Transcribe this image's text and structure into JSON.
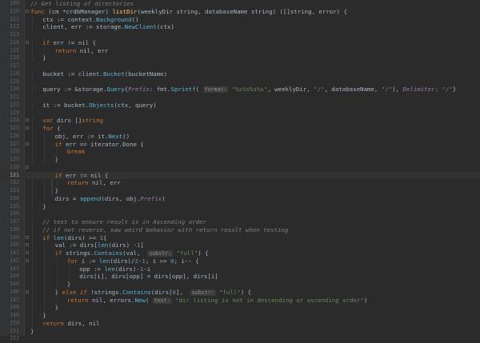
{
  "editor": {
    "line_numbers": [
      "109",
      "110",
      "111",
      "112",
      "113",
      "114",
      "115",
      "116",
      "117",
      "118",
      "119",
      "120",
      "121",
      "122",
      "123",
      "124",
      "125",
      "126",
      "127",
      "128",
      "129",
      "130",
      "131",
      "132",
      "133",
      "134",
      "135",
      "136",
      "137",
      "138",
      "139",
      "140",
      "141",
      "142",
      "143",
      "144",
      "145",
      "146",
      "147",
      "148",
      "149",
      "150",
      "151",
      "152"
    ],
    "current_line": "131",
    "lines": [
      {
        "indent": 0,
        "tokens": [
          {
            "c": "cm",
            "t": "// Get listing of directories"
          }
        ]
      },
      {
        "indent": 0,
        "tokens": [
          {
            "c": "kw",
            "t": "func "
          },
          {
            "t": "(cm *crdbManager) "
          },
          {
            "c": "fn",
            "t": "listDir"
          },
          {
            "t": "(weeklyDir string, databaseName string) ([]string, error) {"
          }
        ]
      },
      {
        "indent": 1,
        "tokens": [
          {
            "t": "ctx := context."
          },
          {
            "c": "call",
            "t": "Background"
          },
          {
            "t": "()"
          }
        ]
      },
      {
        "indent": 1,
        "tokens": [
          {
            "t": "client, err := storage."
          },
          {
            "c": "call",
            "t": "NewClient"
          },
          {
            "t": "(ctx)"
          }
        ]
      },
      {
        "indent": 0,
        "tokens": []
      },
      {
        "indent": 1,
        "tokens": [
          {
            "c": "kw",
            "t": "if "
          },
          {
            "t": "err != nil {"
          }
        ]
      },
      {
        "indent": 2,
        "tokens": [
          {
            "c": "kw",
            "t": "return "
          },
          {
            "t": "nil, err"
          }
        ]
      },
      {
        "indent": 1,
        "tokens": [
          {
            "t": "}"
          }
        ]
      },
      {
        "indent": 0,
        "tokens": []
      },
      {
        "indent": 1,
        "tokens": [
          {
            "t": "bucket := client."
          },
          {
            "c": "call",
            "t": "Bucket"
          },
          {
            "t": "(bucketName)"
          }
        ]
      },
      {
        "indent": 0,
        "tokens": []
      },
      {
        "indent": 1,
        "tokens": [
          {
            "t": "query := &storage."
          },
          {
            "c": "call",
            "t": "Query"
          },
          {
            "t": "{"
          },
          {
            "c": "fld",
            "t": "Prefix"
          },
          {
            "t": ": fmt."
          },
          {
            "c": "call",
            "t": "Sprintf"
          },
          {
            "t": "( "
          },
          {
            "c": "hint",
            "t": "format:"
          },
          {
            "t": " "
          },
          {
            "c": "str",
            "t": "\"%s%s%s%s\""
          },
          {
            "t": ", weeklyDir, "
          },
          {
            "c": "str",
            "t": "\"/\""
          },
          {
            "t": ", databaseName, "
          },
          {
            "c": "str",
            "t": "\"/\""
          },
          {
            "t": "), "
          },
          {
            "c": "fld",
            "t": "Delimiter"
          },
          {
            "t": ": "
          },
          {
            "c": "str",
            "t": "\"/\""
          },
          {
            "t": "}"
          }
        ]
      },
      {
        "indent": 0,
        "tokens": []
      },
      {
        "indent": 1,
        "tokens": [
          {
            "t": "it := bucket."
          },
          {
            "c": "call",
            "t": "Objects"
          },
          {
            "t": "(ctx, query)"
          }
        ]
      },
      {
        "indent": 0,
        "tokens": []
      },
      {
        "indent": 1,
        "tokens": [
          {
            "c": "kw",
            "t": "var "
          },
          {
            "t": "dirs []"
          },
          {
            "c": "kw",
            "t": "string"
          }
        ]
      },
      {
        "indent": 1,
        "tokens": [
          {
            "c": "kw",
            "t": "for "
          },
          {
            "t": "{"
          }
        ]
      },
      {
        "indent": 2,
        "tokens": [
          {
            "t": "obj, err := it."
          },
          {
            "c": "call",
            "t": "Next"
          },
          {
            "t": "()"
          }
        ]
      },
      {
        "indent": 2,
        "tokens": [
          {
            "c": "kw",
            "t": "if "
          },
          {
            "t": "err == iterator.Done {"
          }
        ]
      },
      {
        "indent": 3,
        "tokens": [
          {
            "c": "kw",
            "t": "break"
          }
        ]
      },
      {
        "indent": 2,
        "tokens": [
          {
            "t": "}"
          }
        ]
      },
      {
        "indent": 0,
        "tokens": []
      },
      {
        "indent": 2,
        "tokens": [
          {
            "c": "kw",
            "t": "if "
          },
          {
            "t": "err != nil {"
          }
        ]
      },
      {
        "indent": 3,
        "tokens": [
          {
            "c": "kw",
            "t": "return "
          },
          {
            "t": "nil, err"
          }
        ]
      },
      {
        "indent": 2,
        "tokens": [
          {
            "t": "}"
          }
        ]
      },
      {
        "indent": 2,
        "tokens": [
          {
            "t": "dirs = "
          },
          {
            "c": "call",
            "t": "append"
          },
          {
            "t": "(dirs, obj."
          },
          {
            "c": "fld",
            "t": "Prefix"
          },
          {
            "t": ")"
          }
        ]
      },
      {
        "indent": 1,
        "tokens": [
          {
            "t": "}"
          }
        ]
      },
      {
        "indent": 0,
        "tokens": []
      },
      {
        "indent": 1,
        "tokens": [
          {
            "c": "cm",
            "t": "// test to ensure result is in Ascending order"
          }
        ]
      },
      {
        "indent": 1,
        "tokens": [
          {
            "c": "cm",
            "t": "// if not reverse, saw weird behavior with return result when testing"
          }
        ]
      },
      {
        "indent": 1,
        "tokens": [
          {
            "c": "kw",
            "t": "if "
          },
          {
            "c": "call",
            "t": "len"
          },
          {
            "t": "(dirs) >= "
          },
          {
            "c": "num",
            "t": "1"
          },
          {
            "t": "{"
          }
        ]
      },
      {
        "indent": 2,
        "tokens": [
          {
            "t": "val := dirs["
          },
          {
            "c": "call",
            "t": "len"
          },
          {
            "t": "(dirs) -"
          },
          {
            "c": "num",
            "t": "1"
          },
          {
            "t": "]"
          }
        ]
      },
      {
        "indent": 2,
        "tokens": [
          {
            "c": "kw",
            "t": "if "
          },
          {
            "t": "strings."
          },
          {
            "c": "call",
            "t": "Contains"
          },
          {
            "t": "(val,  "
          },
          {
            "c": "hint",
            "t": "substr:"
          },
          {
            "t": " "
          },
          {
            "c": "str",
            "t": "\"full\""
          },
          {
            "t": ") {"
          }
        ]
      },
      {
        "indent": 3,
        "tokens": [
          {
            "c": "kw",
            "t": "for "
          },
          {
            "t": "i := "
          },
          {
            "c": "call",
            "t": "len"
          },
          {
            "t": "(dirs)/"
          },
          {
            "c": "num",
            "t": "2"
          },
          {
            "t": "-"
          },
          {
            "c": "num",
            "t": "1"
          },
          {
            "t": "; i >= "
          },
          {
            "c": "num",
            "t": "0"
          },
          {
            "t": "; i-- {"
          }
        ]
      },
      {
        "indent": 4,
        "tokens": [
          {
            "t": "opp := "
          },
          {
            "c": "call",
            "t": "len"
          },
          {
            "t": "(dirs)-"
          },
          {
            "c": "num",
            "t": "1"
          },
          {
            "t": "-i"
          }
        ]
      },
      {
        "indent": 4,
        "tokens": [
          {
            "t": "dirs[i], dirs[opp] = dirs[opp], dirs[i]"
          }
        ]
      },
      {
        "indent": 3,
        "tokens": [
          {
            "t": "}"
          }
        ]
      },
      {
        "indent": 2,
        "tokens": [
          {
            "t": "} "
          },
          {
            "c": "kwi",
            "t": "else if "
          },
          {
            "t": "!strings."
          },
          {
            "c": "call",
            "t": "Contains"
          },
          {
            "t": "(dirs["
          },
          {
            "c": "num",
            "t": "0"
          },
          {
            "t": "],  "
          },
          {
            "c": "hint",
            "t": "substr:"
          },
          {
            "t": " "
          },
          {
            "c": "str",
            "t": "\"full\""
          },
          {
            "t": ") {"
          }
        ]
      },
      {
        "indent": 3,
        "tokens": [
          {
            "c": "kw",
            "t": "return "
          },
          {
            "t": "nil, errors."
          },
          {
            "c": "call",
            "t": "New"
          },
          {
            "t": "( "
          },
          {
            "c": "hint",
            "t": "text:"
          },
          {
            "t": " "
          },
          {
            "c": "str",
            "t": "\"dir listing is not in descending or ascending order\""
          },
          {
            "t": ")"
          }
        ]
      },
      {
        "indent": 2,
        "tokens": [
          {
            "t": "}"
          }
        ]
      },
      {
        "indent": 1,
        "tokens": [
          {
            "t": "}"
          }
        ]
      },
      {
        "indent": 1,
        "tokens": [
          {
            "c": "kw",
            "t": "return "
          },
          {
            "t": "dirs, nil"
          }
        ]
      },
      {
        "indent": 0,
        "tokens": [
          {
            "t": "}"
          }
        ]
      },
      {
        "indent": 0,
        "tokens": []
      }
    ]
  },
  "colors": {
    "background": "#2b2b2b",
    "keyword": "#cc7832",
    "comment": "#808080",
    "string": "#6a8759",
    "function_name": "#ffc66d",
    "method_call": "#5cb4d7",
    "number": "#6897bb",
    "field": "#9876aa"
  }
}
